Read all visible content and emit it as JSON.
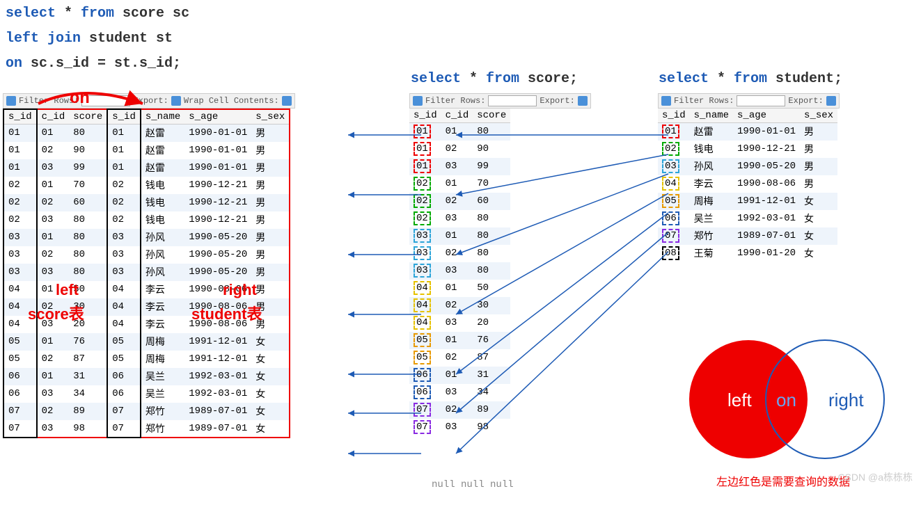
{
  "sql_main": {
    "l1_kw1": "select",
    "l1_t1": " * ",
    "l1_kw2": "from",
    "l1_t2": " score sc",
    "l2_kw1": "left join",
    "l2_t1": " student st",
    "l3_kw1": "on",
    "l3_t1": " sc.s_id = st.s_id;"
  },
  "sql_score": {
    "kw1": "select",
    "t1": " * ",
    "kw2": "from",
    "t2": " score;"
  },
  "sql_student": {
    "kw1": "select",
    "t1": " * ",
    "kw2": "from",
    "t2": " student;"
  },
  "toolbar": {
    "filter": "Filter Rows:",
    "export": "Export:",
    "wrap": "Wrap Cell Contents:"
  },
  "headers_join": {
    "c0": "s_id",
    "c1": "c_id",
    "c2": "score",
    "c3": "s_id",
    "c4": "s_name",
    "c5": "s_age",
    "c6": "s_sex"
  },
  "headers_score": {
    "c0": "s_id",
    "c1": "c_id",
    "c2": "score"
  },
  "headers_student": {
    "c0": "s_id",
    "c1": "s_name",
    "c2": "s_age",
    "c3": "s_sex"
  },
  "join_rows": [
    {
      "a": "01",
      "b": "01",
      "c": "80",
      "d": "01",
      "e": "赵雷",
      "f": "1990-01-01",
      "g": "男"
    },
    {
      "a": "01",
      "b": "02",
      "c": "90",
      "d": "01",
      "e": "赵雷",
      "f": "1990-01-01",
      "g": "男"
    },
    {
      "a": "01",
      "b": "03",
      "c": "99",
      "d": "01",
      "e": "赵雷",
      "f": "1990-01-01",
      "g": "男"
    },
    {
      "a": "02",
      "b": "01",
      "c": "70",
      "d": "02",
      "e": "钱电",
      "f": "1990-12-21",
      "g": "男"
    },
    {
      "a": "02",
      "b": "02",
      "c": "60",
      "d": "02",
      "e": "钱电",
      "f": "1990-12-21",
      "g": "男"
    },
    {
      "a": "02",
      "b": "03",
      "c": "80",
      "d": "02",
      "e": "钱电",
      "f": "1990-12-21",
      "g": "男"
    },
    {
      "a": "03",
      "b": "01",
      "c": "80",
      "d": "03",
      "e": "孙风",
      "f": "1990-05-20",
      "g": "男"
    },
    {
      "a": "03",
      "b": "02",
      "c": "80",
      "d": "03",
      "e": "孙风",
      "f": "1990-05-20",
      "g": "男"
    },
    {
      "a": "03",
      "b": "03",
      "c": "80",
      "d": "03",
      "e": "孙风",
      "f": "1990-05-20",
      "g": "男"
    },
    {
      "a": "04",
      "b": "01",
      "c": "50",
      "d": "04",
      "e": "李云",
      "f": "1990-08-06",
      "g": "男"
    },
    {
      "a": "04",
      "b": "02",
      "c": "30",
      "d": "04",
      "e": "李云",
      "f": "1990-08-06",
      "g": "男"
    },
    {
      "a": "04",
      "b": "03",
      "c": "20",
      "d": "04",
      "e": "李云",
      "f": "1990-08-06",
      "g": "男"
    },
    {
      "a": "05",
      "b": "01",
      "c": "76",
      "d": "05",
      "e": "周梅",
      "f": "1991-12-01",
      "g": "女"
    },
    {
      "a": "05",
      "b": "02",
      "c": "87",
      "d": "05",
      "e": "周梅",
      "f": "1991-12-01",
      "g": "女"
    },
    {
      "a": "06",
      "b": "01",
      "c": "31",
      "d": "06",
      "e": "吴兰",
      "f": "1992-03-01",
      "g": "女"
    },
    {
      "a": "06",
      "b": "03",
      "c": "34",
      "d": "06",
      "e": "吴兰",
      "f": "1992-03-01",
      "g": "女"
    },
    {
      "a": "07",
      "b": "02",
      "c": "89",
      "d": "07",
      "e": "郑竹",
      "f": "1989-07-01",
      "g": "女"
    },
    {
      "a": "07",
      "b": "03",
      "c": "98",
      "d": "07",
      "e": "郑竹",
      "f": "1989-07-01",
      "g": "女"
    }
  ],
  "score_rows": [
    {
      "a": "01",
      "b": "01",
      "c": "80",
      "color": "#e00"
    },
    {
      "a": "01",
      "b": "02",
      "c": "90",
      "color": "#e00"
    },
    {
      "a": "01",
      "b": "03",
      "c": "99",
      "color": "#e00"
    },
    {
      "a": "02",
      "b": "01",
      "c": "70",
      "color": "#0a0"
    },
    {
      "a": "02",
      "b": "02",
      "c": "60",
      "color": "#0a0"
    },
    {
      "a": "02",
      "b": "03",
      "c": "80",
      "color": "#0a0"
    },
    {
      "a": "03",
      "b": "01",
      "c": "80",
      "color": "#2da5d9"
    },
    {
      "a": "03",
      "b": "02",
      "c": "80",
      "color": "#2da5d9"
    },
    {
      "a": "03",
      "b": "03",
      "c": "80",
      "color": "#2da5d9"
    },
    {
      "a": "04",
      "b": "01",
      "c": "50",
      "color": "#e6c200"
    },
    {
      "a": "04",
      "b": "02",
      "c": "30",
      "color": "#e6c200"
    },
    {
      "a": "04",
      "b": "03",
      "c": "20",
      "color": "#e6c200"
    },
    {
      "a": "05",
      "b": "01",
      "c": "76",
      "color": "#e89a00"
    },
    {
      "a": "05",
      "b": "02",
      "c": "87",
      "color": "#e89a00"
    },
    {
      "a": "06",
      "b": "01",
      "c": "31",
      "color": "#1e5bb5"
    },
    {
      "a": "06",
      "b": "03",
      "c": "34",
      "color": "#1e5bb5"
    },
    {
      "a": "07",
      "b": "02",
      "c": "89",
      "color": "#8a2be2"
    },
    {
      "a": "07",
      "b": "03",
      "c": "98",
      "color": "#8a2be2"
    }
  ],
  "student_rows": [
    {
      "a": "01",
      "b": "赵雷",
      "c": "1990-01-01",
      "d": "男",
      "color": "#e00"
    },
    {
      "a": "02",
      "b": "钱电",
      "c": "1990-12-21",
      "d": "男",
      "color": "#0a0"
    },
    {
      "a": "03",
      "b": "孙风",
      "c": "1990-05-20",
      "d": "男",
      "color": "#2da5d9"
    },
    {
      "a": "04",
      "b": "李云",
      "c": "1990-08-06",
      "d": "男",
      "color": "#e6c200"
    },
    {
      "a": "05",
      "b": "周梅",
      "c": "1991-12-01",
      "d": "女",
      "color": "#e89a00"
    },
    {
      "a": "06",
      "b": "吴兰",
      "c": "1992-03-01",
      "d": "女",
      "color": "#1e5bb5"
    },
    {
      "a": "07",
      "b": "郑竹",
      "c": "1989-07-01",
      "d": "女",
      "color": "#8a2be2"
    },
    {
      "a": "08",
      "b": "王菊",
      "c": "1990-01-20",
      "d": "女",
      "color": "#000"
    }
  ],
  "labels": {
    "on": "on",
    "left": "left",
    "score_tbl": "score表",
    "right": "right",
    "student_tbl": "student表"
  },
  "venn": {
    "left": "left",
    "on": "on",
    "right": "right",
    "caption": "左边红色是需要查询的数据"
  },
  "nulltxt": "null  null  null",
  "watermark": "CSDN @a栋栋栋"
}
